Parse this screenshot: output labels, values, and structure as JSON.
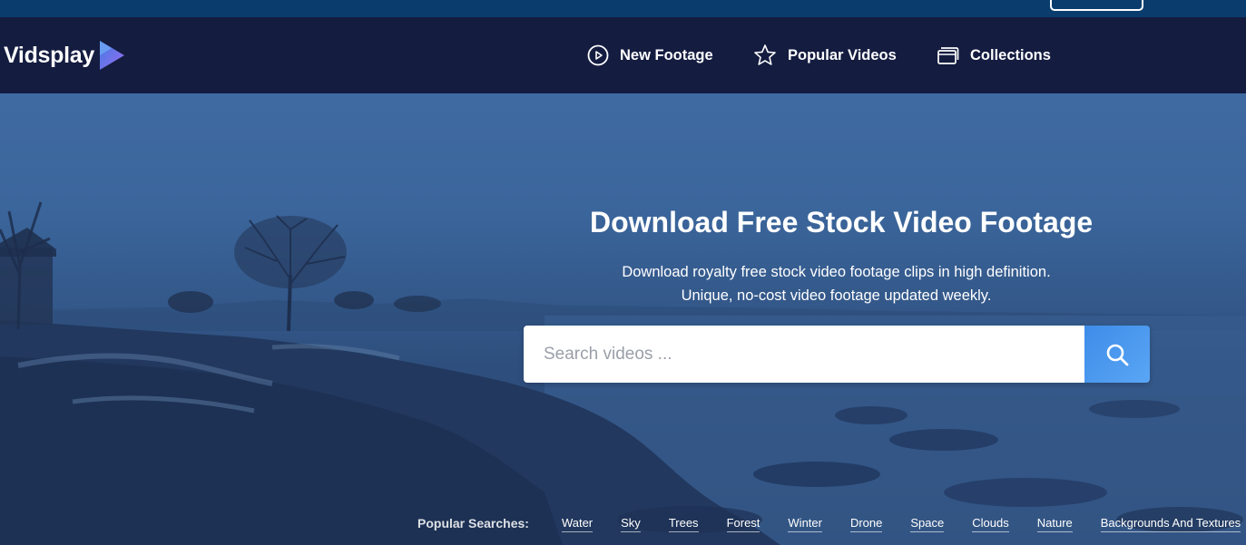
{
  "brand": {
    "name": "Vidsplay",
    "logo_colors": [
      "#4a7de0",
      "#8a6cf0"
    ]
  },
  "nav": {
    "items": [
      {
        "label": "New Footage",
        "icon": "play-circle-icon"
      },
      {
        "label": "Popular Videos",
        "icon": "star-icon"
      },
      {
        "label": "Collections",
        "icon": "collections-icon"
      }
    ]
  },
  "hero": {
    "title": "Download Free Stock Video Footage",
    "subtitle_line1": "Download royalty free stock video footage clips in high definition.",
    "subtitle_line2": "Unique, no-cost video footage updated weekly."
  },
  "search": {
    "placeholder": "Search videos ...",
    "value": "",
    "button_icon": "search-icon"
  },
  "popular": {
    "label": "Popular Searches:",
    "tags": [
      "Water",
      "Sky",
      "Trees",
      "Forest",
      "Winter",
      "Drone",
      "Space",
      "Clouds",
      "Nature",
      "Backgrounds And Textures"
    ]
  },
  "colors": {
    "topbar": "#0a3d6e",
    "navbar": "#141c40",
    "accent": "#4a95ee",
    "text": "#ffffff"
  }
}
